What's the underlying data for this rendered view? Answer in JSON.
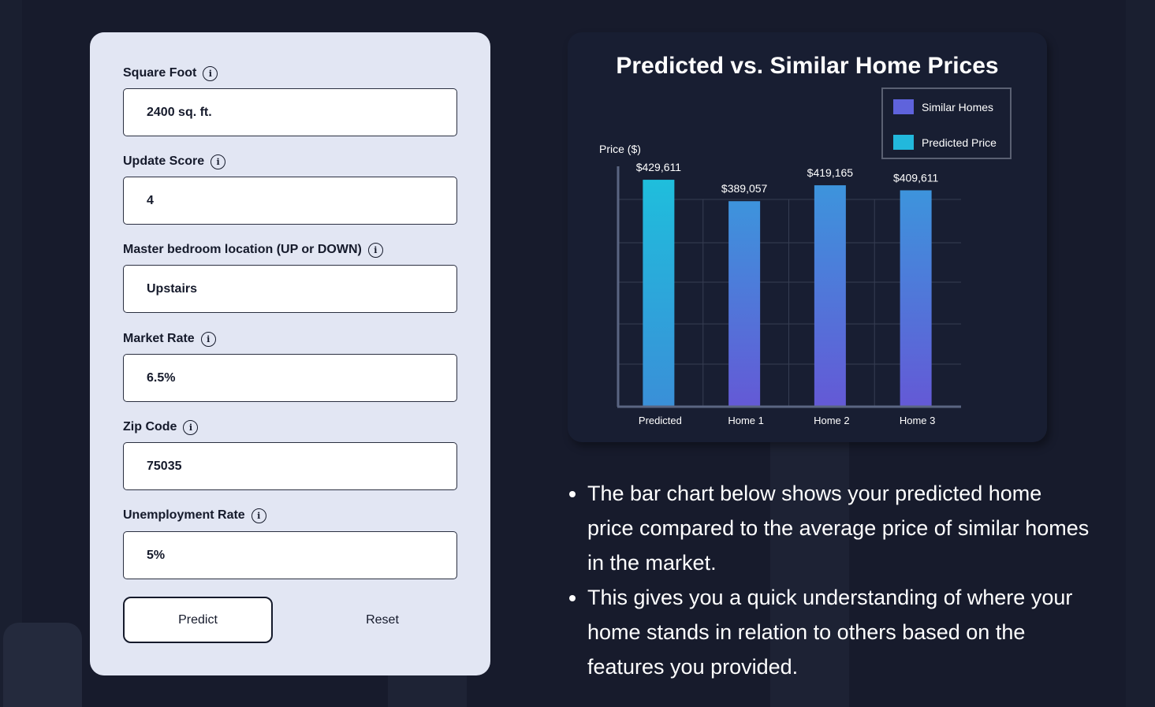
{
  "form": {
    "fields": [
      {
        "label": "Square Foot",
        "value": "2400 sq. ft."
      },
      {
        "label": "Update Score",
        "value": "4"
      },
      {
        "label": "Master bedroom location (UP or DOWN)",
        "value": "Upstairs"
      },
      {
        "label": "Market Rate",
        "value": "6.5%"
      },
      {
        "label": "Zip Code",
        "value": "75035"
      },
      {
        "label": "Unemployment Rate",
        "value": "5%"
      }
    ],
    "info_glyph": "i",
    "predict_label": "Predict",
    "reset_label": "Reset"
  },
  "chart_data": {
    "type": "bar",
    "title": "Predicted vs. Similar Home Prices",
    "ylabel": "Price ($)",
    "xlabel": "",
    "categories": [
      "Predicted",
      "Home 1",
      "Home 2",
      "Home 3"
    ],
    "values": [
      429611,
      389057,
      419165,
      409611
    ],
    "value_labels": [
      "$429,611",
      "$389,057",
      "$419,165",
      "$409,611"
    ],
    "bar_series": [
      "Predicted Price",
      "Similar Homes",
      "Similar Homes",
      "Similar Homes"
    ],
    "legend": [
      {
        "label": "Similar Homes",
        "color": "#5f63dc"
      },
      {
        "label": "Predicted Price",
        "color": "#22b8dc"
      }
    ],
    "legend_position": "top-right",
    "grid": true,
    "ylim": [
      0,
      470000
    ]
  },
  "colors": {
    "predicted_top": "#1fbedc",
    "predicted_bottom": "#3a8fd8",
    "similar_top": "#3d94dc",
    "similar_bottom": "#6459d6"
  },
  "description": {
    "bullets": [
      "The bar chart below shows your predicted home price compared to the average price of similar homes in the market.",
      "This gives you a quick understanding of where your home stands in relation to others based on the features you provided."
    ]
  }
}
